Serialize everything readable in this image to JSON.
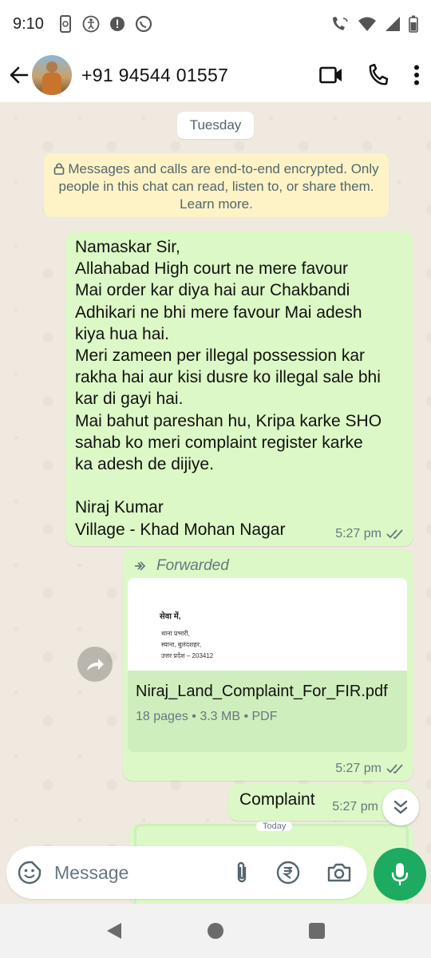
{
  "status_bar": {
    "time": "9:10"
  },
  "header": {
    "contact_name": "+91 94544 01557"
  },
  "chat": {
    "day_label": "Tuesday",
    "encryption_notice": "Messages and calls are end-to-end encrypted. Only people in this chat can read, listen to, or share them. Learn more.",
    "messages": [
      {
        "text": "Namaskar Sir,\nAllahabad High court ne mere favour\nMai order kar diya hai aur Chakbandi\nAdhikari ne bhi mere favour Mai adesh\nkiya hua hai.\nMeri zameen per illegal possession kar\nrakha hai aur kisi dusre ko illegal sale bhi\nkar di gayi hai.\nMai bahut pareshan hu, Kripa karke SHO\nsahab ko meri complaint register karke\nka adesh de dijiye.\n\nNiraj Kumar\nVillage - Khad Mohan Nagar",
        "time": "5:27 pm"
      },
      {
        "forwarded_label": "Forwarded",
        "document": {
          "preview_lines": [
            "सेवा में,",
            "थाना प्रभारी,",
            "स्याना, बुलंदशहर,",
            "उत्तर प्रदेश – 203412"
          ],
          "file_name": "Niraj_Land_Complaint_For_FIR.pdf",
          "info": "18 pages • 3.3 MB • PDF"
        },
        "time": "5:27 pm"
      },
      {
        "text": "Complaint",
        "time": "5:27 pm"
      },
      {
        "partial_chip": "Today"
      }
    ]
  },
  "composer": {
    "placeholder": "Message"
  }
}
